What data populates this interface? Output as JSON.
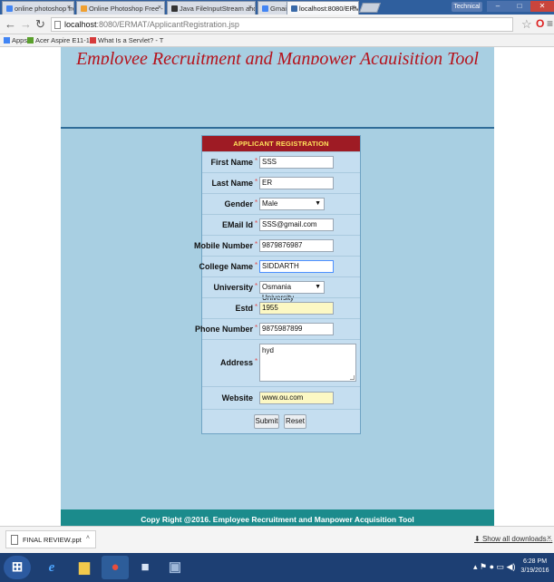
{
  "browser": {
    "tabs": [
      {
        "label": "online photoshop free - G",
        "color": "#4285f4"
      },
      {
        "label": "Online Photoshop Free - ",
        "color": "#f0a030"
      },
      {
        "label": "Java FileInputStream and",
        "color": "#333333"
      },
      {
        "label": "Gmail",
        "color": "#4285f4"
      },
      {
        "label": "localhost:8080/ERMAT/A",
        "color": "#3a6aa8"
      }
    ],
    "profile_label": "Technical",
    "url_host": "localhost",
    "url_path": ":8080/ERMAT/ApplicantRegistration.jsp",
    "bookmarks": [
      {
        "label": "Apps",
        "color": "#4285f4"
      },
      {
        "label": "Acer Aspire E11-111",
        "color": "#5aa02c"
      },
      {
        "label": "What Is a Servlet? - T",
        "color": "#d63b3b"
      }
    ]
  },
  "page": {
    "title": "Employee Recruitment and Manpower Acquisition Tool",
    "form_title": "APPLICANT REGISTRATION",
    "required_mark": "*",
    "fields": {
      "first_name": {
        "label": "First Name",
        "value": "SSS"
      },
      "last_name": {
        "label": "Last Name",
        "value": "ER"
      },
      "gender": {
        "label": "Gender",
        "value": "Male"
      },
      "email": {
        "label": "EMail Id",
        "value": "SSS@gmail.com"
      },
      "mobile": {
        "label": "Mobile Number",
        "value": "9879876987"
      },
      "college": {
        "label": "College Name",
        "value": "SIDDARTH"
      },
      "university": {
        "label": "University",
        "value": "Osmania University"
      },
      "estd": {
        "label": "Estd",
        "value": "1955"
      },
      "phone": {
        "label": "Phone Number",
        "value": "9875987899"
      },
      "address": {
        "label": "Address",
        "value": "hyd"
      },
      "website": {
        "label": "Website",
        "value": "www.ou.com"
      }
    },
    "submit_label": "Submit",
    "reset_label": "Reset",
    "footer": "Copy Right @2016.   Employee Recruitment and Manpower Acquisition Tool"
  },
  "downloads": {
    "file": "FINAL REVIEW.ppt",
    "show_all": "Show all downloads..."
  },
  "taskbar": {
    "time": "6:28 PM",
    "date": "3/19/2016"
  }
}
